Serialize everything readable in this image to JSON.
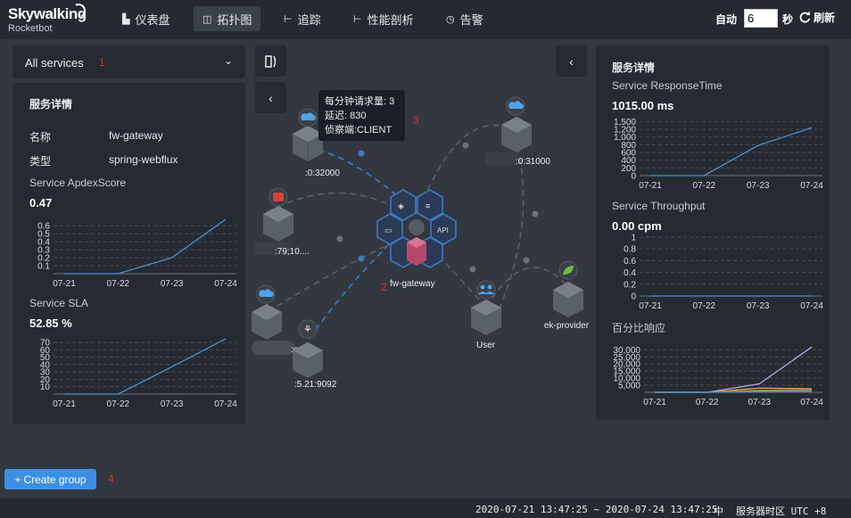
{
  "brand": {
    "name": "Skywalking",
    "sub": "Rocketbot"
  },
  "nav": [
    {
      "label": "仪表盘",
      "icon": "dashboard-icon",
      "glyph": "▙"
    },
    {
      "label": "拓扑图",
      "icon": "topology-icon",
      "glyph": "◫"
    },
    {
      "label": "追踪",
      "icon": "trace-icon",
      "glyph": "⊢"
    },
    {
      "label": "性能剖析",
      "icon": "profile-icon",
      "glyph": "⊢"
    },
    {
      "label": "告警",
      "icon": "alarm-icon",
      "glyph": "◷"
    }
  ],
  "auto_refresh": {
    "label": "自动",
    "value": "6",
    "unit": "秒",
    "refresh_label": "刷新"
  },
  "service_select": {
    "value": "All services"
  },
  "annotations": [
    "1",
    "2",
    "3",
    "4"
  ],
  "left_panel": {
    "title": "服务详情",
    "fields": [
      {
        "key": "名称",
        "value": "fw-gateway"
      },
      {
        "key": "类型",
        "value": "spring-webflux"
      }
    ],
    "apdex": {
      "label": "Service ApdexScore",
      "value": "0.47"
    },
    "sla": {
      "label": "Service SLA",
      "value": "52.85 %"
    }
  },
  "right_panel": {
    "title": "服务详情",
    "response_time": {
      "label": "Service ResponseTime",
      "value": "1015.00 ms"
    },
    "throughput": {
      "label": "Service Throughput",
      "value": "0.00 cpm"
    },
    "percentile": {
      "label": "百分比响应"
    }
  },
  "topology": {
    "nodes": [
      {
        "label": ":0:32000",
        "icon": "cloud-icon"
      },
      {
        "label": ":79;10....",
        "icon": "redis-icon"
      },
      {
        "label": ":om:...",
        "icon": "cloud-icon"
      },
      {
        "label": ":5.21:9092",
        "icon": "kafka-icon"
      },
      {
        "label": "fw-gateway",
        "icon": "gateway-hex-icon"
      },
      {
        "label": ":0:31000",
        "icon": "cloud-icon"
      },
      {
        "label": "User",
        "icon": "users-icon"
      },
      {
        "label": "ek-provider",
        "icon": "spring-leaf-icon"
      }
    ],
    "tooltip": {
      "line1": "每分钟请求量: 3",
      "line2": "延迟: 830",
      "line3": "侦察端:CLIENT"
    }
  },
  "create_group": {
    "label": "Create group"
  },
  "footer": {
    "range": "2020-07-21 13:47:25 ~ 2020-07-24 13:47:25",
    "lang": "中",
    "tz": "服务器时区 UTC +8"
  },
  "chart_data": [
    {
      "type": "line",
      "title": "Service ApdexScore",
      "categories": [
        "07-21",
        "07-22",
        "07-23",
        "07-24"
      ],
      "series": [
        {
          "values": [
            0.0,
            0.0,
            0.2,
            0.68
          ]
        }
      ],
      "yticks": [
        0.1,
        0.2,
        0.3,
        0.4,
        0.5,
        0.6
      ],
      "ylim": [
        0,
        0.68
      ],
      "color": "#4a8fd6"
    },
    {
      "type": "line",
      "title": "Service SLA",
      "categories": [
        "07-21",
        "07-22",
        "07-23",
        "07-24"
      ],
      "series": [
        {
          "values": [
            0,
            0,
            37,
            75
          ]
        }
      ],
      "yticks": [
        10,
        20,
        30,
        40,
        50,
        60,
        70
      ],
      "ylim": [
        0,
        75
      ],
      "color": "#4a8fd6"
    },
    {
      "type": "line",
      "title": "Service ResponseTime",
      "categories": [
        "07-21",
        "07-22",
        "07-23",
        "07-24"
      ],
      "series": [
        {
          "values": [
            0,
            0,
            780,
            1240
          ]
        }
      ],
      "yticks": [
        0,
        200,
        400,
        600,
        800,
        1000,
        1200,
        1400
      ],
      "ytick_labels": [
        "0",
        "200",
        "400",
        "600",
        "800",
        "1,000",
        "1,200",
        "1,500"
      ],
      "ylim": [
        0,
        1500
      ],
      "color": "#4a8fd6"
    },
    {
      "type": "line",
      "title": "Service Throughput",
      "categories": [
        "07-21",
        "07-22",
        "07-23",
        "07-24"
      ],
      "series": [
        {
          "values": [
            0,
            0,
            0,
            0
          ]
        }
      ],
      "yticks": [
        0,
        0.2,
        0.4,
        0.6,
        0.8,
        1
      ],
      "ylim": [
        0,
        1
      ],
      "color": "#4a8fd6"
    },
    {
      "type": "line",
      "title": "百分比响应",
      "categories": [
        "07-21",
        "07-22",
        "07-23",
        "07-24"
      ],
      "series": [
        {
          "values": [
            0,
            0,
            6000,
            32000
          ],
          "color": "#b9a6e0"
        },
        {
          "values": [
            0,
            0,
            3000,
            2500
          ],
          "color": "#e3a54a"
        },
        {
          "values": [
            0,
            0,
            1500,
            1800
          ],
          "color": "#e05f5f"
        },
        {
          "values": [
            0,
            0,
            900,
            1200
          ],
          "color": "#5fb878"
        },
        {
          "values": [
            0,
            0,
            300,
            600
          ],
          "color": "#4a8fd6"
        }
      ],
      "yticks": [
        5000,
        10000,
        15000,
        20000,
        25000,
        30000
      ],
      "ytick_labels": [
        "5,000",
        "10,000",
        "15,000",
        "20,000",
        "25,000",
        "30,000"
      ],
      "ylim": [
        0,
        34000
      ]
    }
  ]
}
